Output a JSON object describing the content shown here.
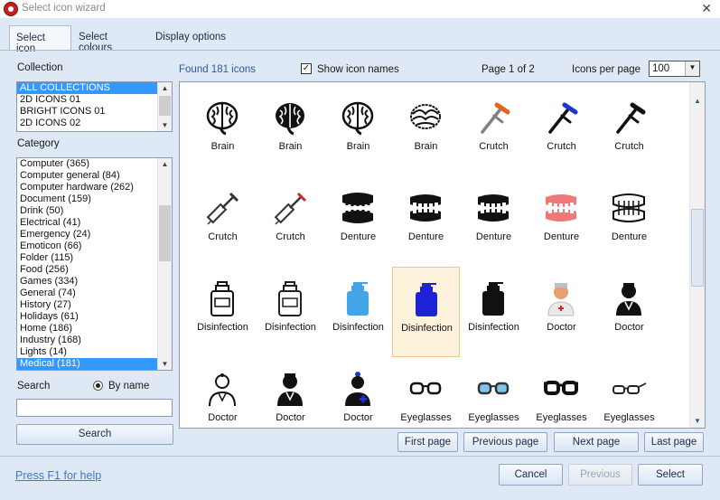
{
  "window": {
    "title": "Select icon wizard",
    "close_glyph": "✕"
  },
  "tabs": [
    {
      "label": "Select icon",
      "active": true
    },
    {
      "label": "Select colours",
      "active": false
    },
    {
      "label": "Display options",
      "active": false
    }
  ],
  "collection": {
    "label": "Collection",
    "items": [
      {
        "label": "ALL COLLECTIONS",
        "selected": true
      },
      {
        "label": "2D ICONS 01",
        "selected": false
      },
      {
        "label": "BRIGHT ICONS 01",
        "selected": false
      },
      {
        "label": "2D ICONS 02",
        "selected": false
      }
    ]
  },
  "category": {
    "label": "Category",
    "items": [
      {
        "label": "Computer (365)",
        "selected": false
      },
      {
        "label": "Computer general (84)",
        "selected": false
      },
      {
        "label": "Computer hardware (262)",
        "selected": false
      },
      {
        "label": "Document (159)",
        "selected": false
      },
      {
        "label": "Drink (50)",
        "selected": false
      },
      {
        "label": "Electrical (41)",
        "selected": false
      },
      {
        "label": "Emergency (24)",
        "selected": false
      },
      {
        "label": "Emoticon (66)",
        "selected": false
      },
      {
        "label": "Folder (115)",
        "selected": false
      },
      {
        "label": "Food (256)",
        "selected": false
      },
      {
        "label": "Games (334)",
        "selected": false
      },
      {
        "label": "General (74)",
        "selected": false
      },
      {
        "label": "History (27)",
        "selected": false
      },
      {
        "label": "Holidays (61)",
        "selected": false
      },
      {
        "label": "Home (186)",
        "selected": false
      },
      {
        "label": "Industry (168)",
        "selected": false
      },
      {
        "label": "Lights (14)",
        "selected": false
      },
      {
        "label": "Medical (181)",
        "selected": true
      }
    ]
  },
  "search": {
    "label": "Search",
    "by_name_label": "By name",
    "value": "",
    "button_label": "Search"
  },
  "results": {
    "found_text": "Found 181 icons",
    "show_names_label": "Show icon names",
    "show_names_checked": true,
    "check_glyph": "✓",
    "page_text": "Page 1 of 2",
    "per_page_label": "Icons per page",
    "per_page_value": "100"
  },
  "icons": [
    {
      "name": "Brain",
      "type": "brain",
      "color": "#111111",
      "selected": false
    },
    {
      "name": "Brain",
      "type": "brain-solid",
      "color": "#111111",
      "selected": false
    },
    {
      "name": "Brain",
      "type": "brain",
      "color": "#111111",
      "selected": false
    },
    {
      "name": "Brain",
      "type": "brain-sketch",
      "color": "#111111",
      "selected": false
    },
    {
      "name": "Crutch",
      "type": "crutch",
      "color": "#7f7f7f",
      "accent": "#e8641e",
      "selected": false
    },
    {
      "name": "Crutch",
      "type": "crutch",
      "color": "#111111",
      "accent": "#1f35d1",
      "selected": false
    },
    {
      "name": "Crutch",
      "type": "crutch",
      "color": "#111111",
      "accent": "#111111",
      "selected": false
    },
    {
      "name": "Crutch",
      "type": "syringe",
      "color": "#333333",
      "selected": false
    },
    {
      "name": "Crutch",
      "type": "syringe",
      "color": "#333333",
      "accent": "#c72b2b",
      "selected": false
    },
    {
      "name": "Denture",
      "type": "denture-open",
      "color": "#111111",
      "selected": false
    },
    {
      "name": "Denture",
      "type": "denture",
      "color": "#111111",
      "selected": false
    },
    {
      "name": "Denture",
      "type": "denture",
      "color": "#111111",
      "selected": false
    },
    {
      "name": "Denture",
      "type": "denture",
      "color": "#f07878",
      "selected": false
    },
    {
      "name": "Denture",
      "type": "denture-outline",
      "color": "#111111",
      "selected": false
    },
    {
      "name": "Disinfection",
      "type": "bottle-outline",
      "color": "#111111",
      "selected": false
    },
    {
      "name": "Disinfection",
      "type": "bottle-outline",
      "color": "#222222",
      "selected": false
    },
    {
      "name": "Disinfection",
      "type": "bottle",
      "color": "#43a4e8",
      "selected": false
    },
    {
      "name": "Disinfection",
      "type": "bottle",
      "color": "#1e22d6",
      "selected": true
    },
    {
      "name": "Disinfection",
      "type": "bottle",
      "color": "#111111",
      "selected": false
    },
    {
      "name": "Doctor",
      "type": "doctor-color",
      "color": "#e8a070",
      "selected": false
    },
    {
      "name": "Doctor",
      "type": "doctor",
      "color": "#111111",
      "selected": false
    },
    {
      "name": "Doctor",
      "type": "doctor-outline",
      "color": "#111111",
      "selected": false
    },
    {
      "name": "Doctor",
      "type": "doctor",
      "color": "#111111",
      "selected": false
    },
    {
      "name": "Doctor",
      "type": "doctor-blue",
      "color": "#111111",
      "accent": "#1f35d1",
      "selected": false
    },
    {
      "name": "Eyeglasses",
      "type": "glasses",
      "color": "#111111",
      "selected": false
    },
    {
      "name": "Eyeglasses",
      "type": "glasses",
      "color": "#333333",
      "accent": "#7ec3ec",
      "selected": false
    },
    {
      "name": "Eyeglasses",
      "type": "glasses-thick",
      "color": "#111111",
      "selected": false
    },
    {
      "name": "Eyeglasses",
      "type": "glasses-side",
      "color": "#222222",
      "selected": false
    }
  ],
  "paging": {
    "first": "First page",
    "previous": "Previous page",
    "next": "Next page",
    "last": "Last page"
  },
  "footer": {
    "help": "Press F1 for help",
    "cancel": "Cancel",
    "previous": "Previous",
    "select": "Select"
  }
}
